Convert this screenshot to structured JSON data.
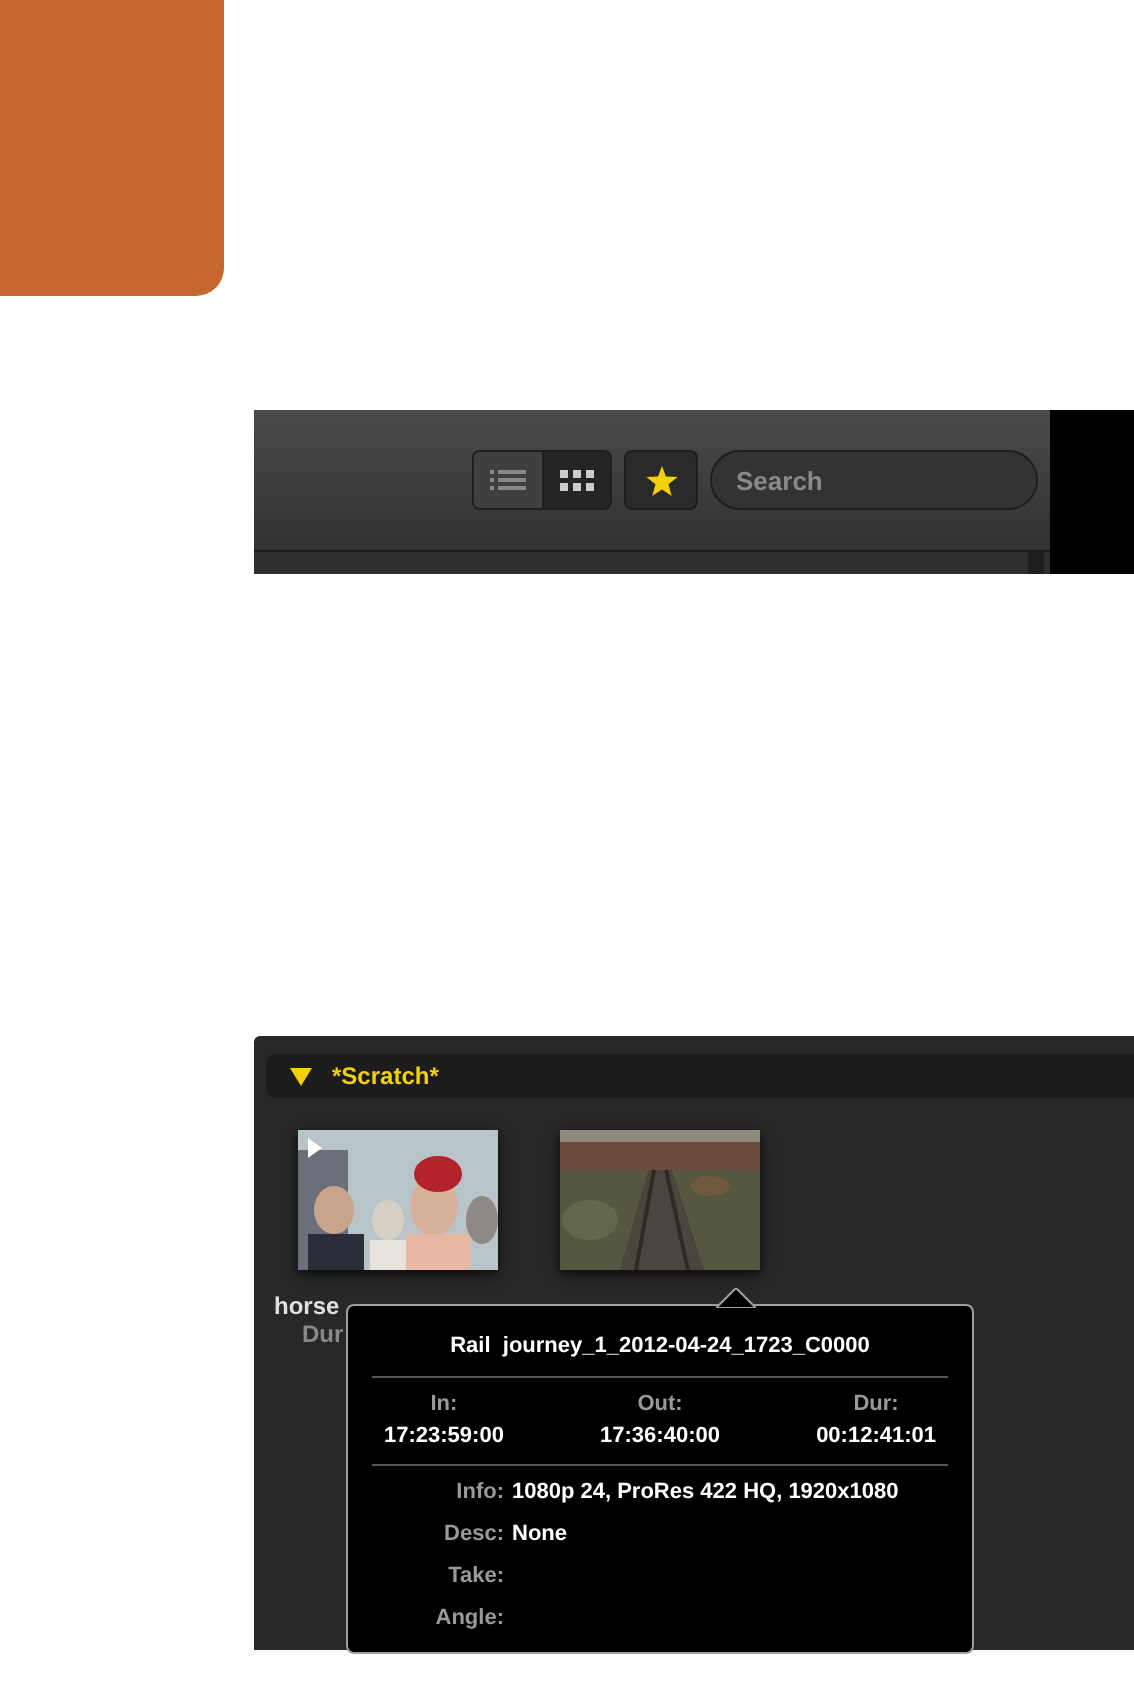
{
  "toolbar": {
    "view_buttons": [
      {
        "kind": "list",
        "selected": false
      },
      {
        "kind": "grid",
        "selected": true
      }
    ],
    "favorites": {
      "on": true
    },
    "search": {
      "placeholder": "Search"
    }
  },
  "bin": {
    "title": "*Scratch*",
    "expanded": true,
    "clips": [
      {
        "kind": "picture",
        "name": "horse",
        "detail": "Dur"
      },
      {
        "kind": "picture"
      }
    ],
    "tooltip": {
      "title": "Rail  journey_1_2012-04-24_1723_C0000",
      "timecodes": [
        {
          "label": "In:",
          "value": "17:23:59:00"
        },
        {
          "label": "Out:",
          "value": "17:36:40:00"
        },
        {
          "label": "Dur:",
          "value": "00:12:41:01"
        }
      ],
      "fields": [
        {
          "label": "Info:",
          "value": "1080p 24, ProRes 422 HQ, 1920x1080"
        },
        {
          "label": "Desc:",
          "value": "None"
        },
        {
          "label": "Take:"
        },
        {
          "label": "Angle:"
        }
      ]
    }
  }
}
